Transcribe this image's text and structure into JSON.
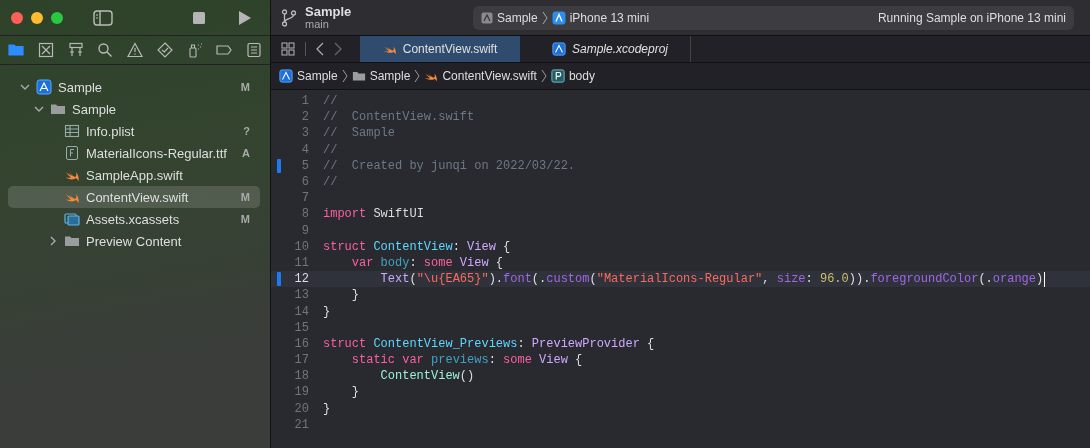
{
  "toolbar": {
    "project": "Sample",
    "branch": "main",
    "scheme": "Sample",
    "destination": "iPhone 13 mini",
    "status": "Running Sample on iPhone 13 mini"
  },
  "navigator_tabs": [
    {
      "selected": true
    },
    {
      "selected": false
    },
    {
      "selected": false
    },
    {
      "selected": false
    },
    {
      "selected": false
    },
    {
      "selected": false
    },
    {
      "selected": false
    },
    {
      "selected": false
    },
    {
      "selected": false
    }
  ],
  "tree": [
    {
      "label": "Sample",
      "kind": "project",
      "badge": "M",
      "selected": false,
      "expanded": true,
      "children": [
        {
          "label": "Sample",
          "kind": "folder",
          "selected": false,
          "expanded": true,
          "children": [
            {
              "label": "Info.plist",
              "kind": "plist",
              "badge": "?",
              "selected": false
            },
            {
              "label": "MaterialIcons-Regular.ttf",
              "kind": "font",
              "badge": "A",
              "selected": false
            },
            {
              "label": "SampleApp.swift",
              "kind": "swift",
              "selected": false
            },
            {
              "label": "ContentView.swift",
              "kind": "swift",
              "badge": "M",
              "selected": true
            },
            {
              "label": "Assets.xcassets",
              "kind": "assets",
              "badge": "M",
              "selected": false
            },
            {
              "label": "Preview Content",
              "kind": "folder",
              "selected": false,
              "expanded": false
            }
          ]
        }
      ]
    }
  ],
  "editor_tabs": [
    {
      "label": "ContentView.swift",
      "kind": "swift",
      "selected": true,
      "preview": false
    },
    {
      "label": "Sample.xcodeproj",
      "kind": "project",
      "selected": false,
      "preview": true
    }
  ],
  "breadcrumb": [
    {
      "label": "Sample",
      "kind": "project"
    },
    {
      "label": "Sample",
      "kind": "folder"
    },
    {
      "label": "ContentView.swift",
      "kind": "swift"
    },
    {
      "label": "body",
      "kind": "property"
    }
  ],
  "code": [
    {
      "number": "1",
      "changed": false,
      "current": false,
      "tokens": [
        {
          "t": "//",
          "color": "#6c7986"
        }
      ]
    },
    {
      "number": "2",
      "changed": false,
      "current": false,
      "tokens": [
        {
          "t": "//  ContentView.swift",
          "color": "#6c7986"
        }
      ]
    },
    {
      "number": "3",
      "changed": false,
      "current": false,
      "tokens": [
        {
          "t": "//  Sample",
          "color": "#6c7986"
        }
      ]
    },
    {
      "number": "4",
      "changed": false,
      "current": false,
      "tokens": [
        {
          "t": "//",
          "color": "#6c7986"
        }
      ]
    },
    {
      "number": "5",
      "changed": true,
      "current": false,
      "tokens": [
        {
          "t": "//  Created by junqi on 2022/03/22.",
          "color": "#6c7986"
        }
      ]
    },
    {
      "number": "6",
      "changed": false,
      "current": false,
      "tokens": [
        {
          "t": "//",
          "color": "#6c7986"
        }
      ]
    },
    {
      "number": "7",
      "changed": false,
      "current": false
    },
    {
      "number": "8",
      "changed": false,
      "current": false,
      "tokens": [
        {
          "t": "import",
          "color": "#fc5fa3"
        },
        {
          "t": " SwiftUI"
        }
      ]
    },
    {
      "number": "9",
      "changed": false,
      "current": false
    },
    {
      "number": "10",
      "changed": false,
      "current": false,
      "tokens": [
        {
          "t": "struct",
          "color": "#fc5fa3"
        },
        {
          "t": " ContentView",
          "color": "#5dd8ff"
        },
        {
          "t": ": "
        },
        {
          "t": "View",
          "color": "#d0a8ff"
        },
        {
          "t": " {"
        }
      ]
    },
    {
      "number": "11",
      "changed": false,
      "current": false,
      "tokens": [
        {
          "t": "    var",
          "color": "#fc5fa3"
        },
        {
          "t": " body",
          "color": "#41a1c0"
        },
        {
          "t": ": "
        },
        {
          "t": "some",
          "color": "#fc5fa3"
        },
        {
          "t": " View",
          "color": "#d0a8ff"
        },
        {
          "t": " {"
        }
      ]
    },
    {
      "number": "12",
      "changed": true,
      "current": true,
      "tokens": [
        {
          "t": "        Text",
          "color": "#d0a8ff"
        },
        {
          "t": "("
        },
        {
          "t": "\"\\u{EA65}\"",
          "color": "#fc6a5d"
        },
        {
          "t": ")."
        },
        {
          "t": "font",
          "color": "#a167e6"
        },
        {
          "t": "(."
        },
        {
          "t": "custom",
          "color": "#a167e6"
        },
        {
          "t": "("
        },
        {
          "t": "\"MaterialIcons-Regular\"",
          "color": "#fc6a5d"
        },
        {
          "t": ", "
        },
        {
          "t": "size",
          "color": "#a167e6"
        },
        {
          "t": ": "
        },
        {
          "t": "96.0",
          "color": "#d0bf69"
        },
        {
          "t": "))."
        },
        {
          "t": "foregroundColor",
          "color": "#a167e6"
        },
        {
          "t": "(."
        },
        {
          "t": "orange",
          "color": "#a167e6"
        },
        {
          "t": ")"
        }
      ]
    },
    {
      "number": "13",
      "changed": false,
      "current": false,
      "tokens": [
        {
          "t": "    }"
        }
      ]
    },
    {
      "number": "14",
      "changed": false,
      "current": false,
      "tokens": [
        {
          "t": "}"
        }
      ]
    },
    {
      "number": "15",
      "changed": false,
      "current": false
    },
    {
      "number": "16",
      "changed": false,
      "current": false,
      "tokens": [
        {
          "t": "struct",
          "color": "#fc5fa3"
        },
        {
          "t": " ContentView_Previews",
          "color": "#5dd8ff"
        },
        {
          "t": ": "
        },
        {
          "t": "PreviewProvider",
          "color": "#d0a8ff"
        },
        {
          "t": " {"
        }
      ]
    },
    {
      "number": "17",
      "changed": false,
      "current": false,
      "tokens": [
        {
          "t": "    static",
          "color": "#fc5fa3"
        },
        {
          "t": " var",
          "color": "#fc5fa3"
        },
        {
          "t": " previews",
          "color": "#41a1c0"
        },
        {
          "t": ": "
        },
        {
          "t": "some",
          "color": "#fc5fa3"
        },
        {
          "t": " View",
          "color": "#d0a8ff"
        },
        {
          "t": " {"
        }
      ]
    },
    {
      "number": "18",
      "changed": false,
      "current": false,
      "tokens": [
        {
          "t": "        ContentView",
          "color": "#9ef1dd"
        },
        {
          "t": "()"
        }
      ]
    },
    {
      "number": "19",
      "changed": false,
      "current": false,
      "tokens": [
        {
          "t": "    }"
        }
      ]
    },
    {
      "number": "20",
      "changed": false,
      "current": false,
      "tokens": [
        {
          "t": "}"
        }
      ]
    },
    {
      "number": "21",
      "changed": false,
      "current": false
    }
  ]
}
